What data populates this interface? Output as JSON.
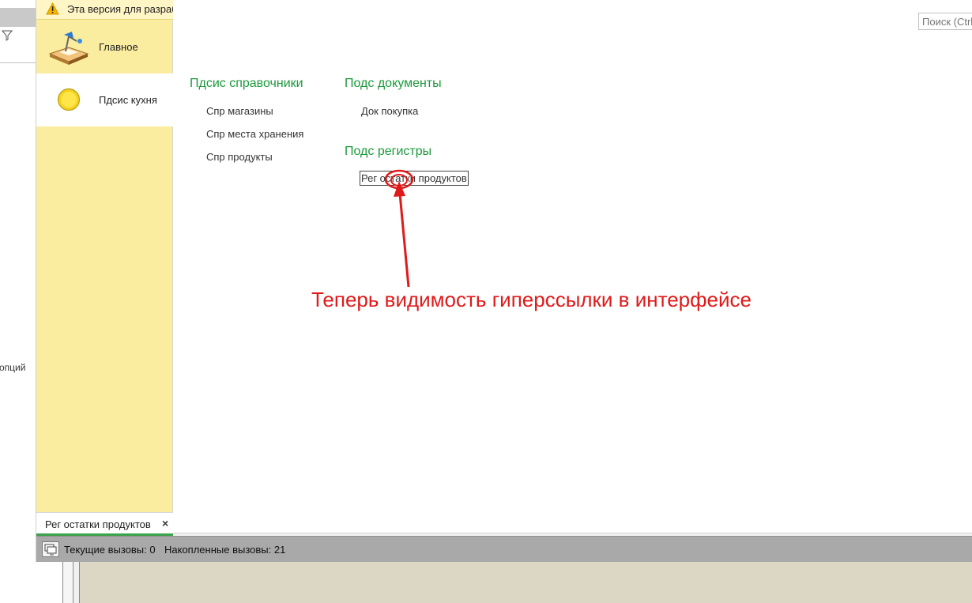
{
  "warning": {
    "text": "Эта версия для разработки"
  },
  "sections": [
    {
      "label": "Главное",
      "icon": "desk-lamp-icon"
    },
    {
      "label": "Пдсис кухня",
      "icon": "yellow-circle-icon"
    }
  ],
  "left_strip": {
    "truncated_text": "опций"
  },
  "search": {
    "placeholder": "Поиск (Ctrl+F)"
  },
  "groups": {
    "directories": {
      "title": "Пдсис справочники",
      "links": [
        "Спр магазины",
        "Спр места хранения",
        "Спр продукты"
      ]
    },
    "documents": {
      "title": "Подс документы",
      "links": [
        "Док покупка"
      ]
    },
    "registers": {
      "title": "Подс регистры",
      "links": [
        "Рег остатки продуктов"
      ]
    }
  },
  "annotation": {
    "text": "Теперь видимость гиперссылки в интерфейсе",
    "color": "#e01a1a"
  },
  "open_tab": {
    "label": "Рег остатки продуктов",
    "close": "×"
  },
  "status": {
    "current_calls": "Текущие вызовы: 0",
    "accumulated_calls": "Накопленные вызовы: 21"
  },
  "colors": {
    "panel_bg": "#faeda0",
    "group_title": "#1a9a3a",
    "status_bg": "#a9a9a9"
  }
}
